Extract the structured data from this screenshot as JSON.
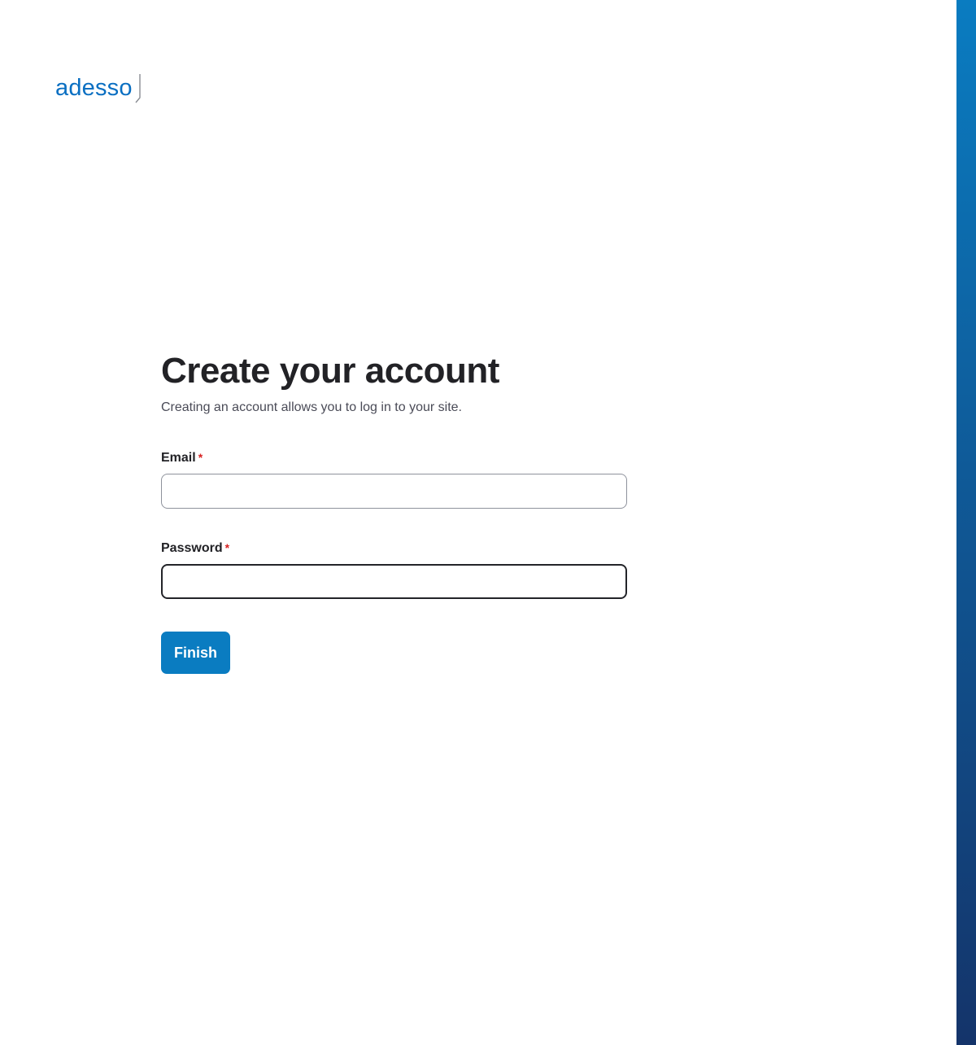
{
  "brand": {
    "logo_text": "adesso",
    "logo_color": "#0a6fc2",
    "logo_mark_icon": "bracket-mark-icon"
  },
  "form": {
    "title": "Create your account",
    "subtitle": "Creating an account allows you to log in to your site.",
    "fields": [
      {
        "label": "Email",
        "required_marker": "*",
        "value": "",
        "placeholder": "",
        "type": "email",
        "focused": false
      },
      {
        "label": "Password",
        "required_marker": "*",
        "value": "",
        "placeholder": "",
        "type": "password",
        "focused": true
      }
    ],
    "submit_label": "Finish"
  },
  "colors": {
    "accent": "#0a7cc1",
    "required": "#d72222",
    "side_band_top": "#0a7cc1",
    "side_band_bottom": "#14346a"
  }
}
